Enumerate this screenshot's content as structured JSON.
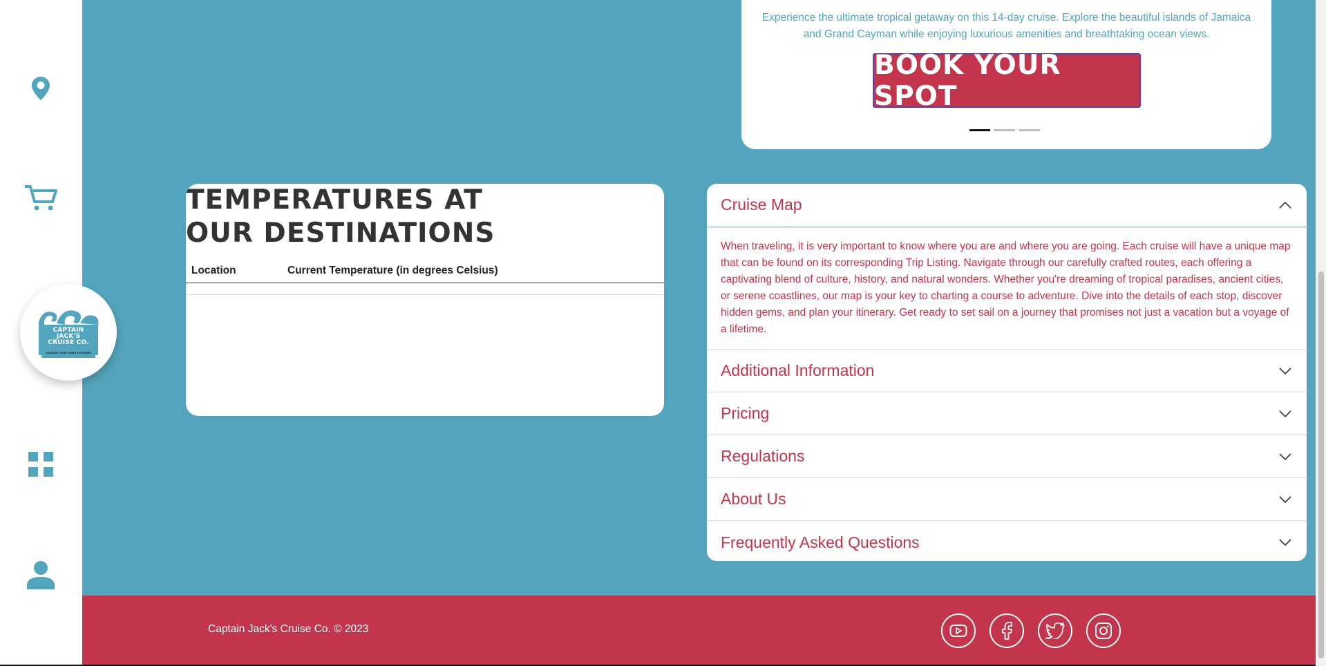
{
  "promo": {
    "description": "Experience the ultimate tropical getaway on this 14-day cruise. Explore the beautiful islands of Jamaica and Grand Cayman while enjoying luxurious amenities and breathtaking ocean views.",
    "button_label": "Book your spot",
    "carousel_active_index": 0,
    "carousel_count": 3
  },
  "brand": {
    "logo_text": "CAPTAIN JACK'S CRUISE CO.",
    "logo_tagline": "UNLEASH YOUR INNER EXPLORER"
  },
  "sidebar": {
    "items": [
      {
        "icon": "map-pin-icon"
      },
      {
        "icon": "cart-icon"
      },
      {
        "icon": "grid-icon"
      },
      {
        "icon": "user-icon"
      }
    ]
  },
  "temperatures": {
    "title": "Temperatures at our destinations",
    "columns": [
      "Location",
      "Current Temperature (in degrees Celsius)"
    ],
    "rows": []
  },
  "accordion": {
    "sections": [
      {
        "title": "Cruise Map",
        "open": true,
        "body": "When traveling, it is very important to know where you are and where you are going. Each cruise will have a unique map that can be found on its corresponding Trip Listing. Navigate through our carefully crafted routes, each offering a captivating blend of culture, history, and natural wonders. Whether you're dreaming of tropical paradises, ancient cities, or serene coastlines, our map is your key to charting a course to adventure. Dive into the details of each stop, discover hidden gems, and plan your itinerary. Get ready to set sail on a journey that promises not just a vacation but a voyage of a lifetime."
      },
      {
        "title": "Additional Information",
        "open": false
      },
      {
        "title": "Pricing",
        "open": false
      },
      {
        "title": "Regulations",
        "open": false
      },
      {
        "title": "About Us",
        "open": false
      },
      {
        "title": "Frequently Asked Questions",
        "open": false
      }
    ]
  },
  "footer": {
    "copyright": "Captain Jack's Cruise Co. © 2023",
    "socials": [
      "youtube-icon",
      "facebook-icon",
      "twitter-icon",
      "instagram-icon"
    ]
  },
  "colors": {
    "background": "#53a5bd",
    "accent": "#c2354d",
    "sidebar": "#ffffff"
  }
}
